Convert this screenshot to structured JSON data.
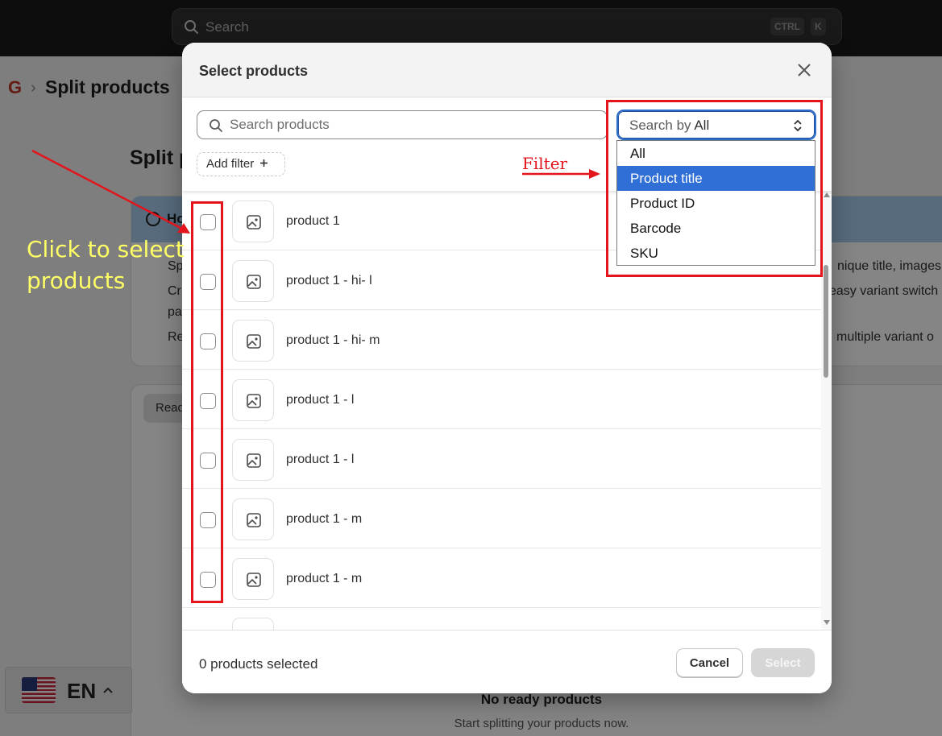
{
  "topbar": {
    "search_placeholder": "Search",
    "shortcut_keys": [
      "CTRL",
      "K"
    ]
  },
  "breadcrumb": {
    "logo": "G",
    "separator": "›",
    "title": "Split products"
  },
  "page": {
    "heading": "Split p",
    "info_title": "Ho",
    "info_lines": [
      "Sp",
      "Cr",
      "pa",
      "Re"
    ],
    "info_right_lines": [
      "nique title, images,",
      "easy variant switch",
      "multiple variant o"
    ],
    "tab_label": "Read",
    "empty_title": "No ready products",
    "empty_subtitle": "Start splitting your products now."
  },
  "language": {
    "code": "EN"
  },
  "modal": {
    "title": "Select products",
    "search_placeholder": "Search products",
    "search_by_label": "Search by",
    "search_by_value": "All",
    "add_filter_label": "Add filter",
    "dropdown_options": [
      "All",
      "Product title",
      "Product ID",
      "Barcode",
      "SKU"
    ],
    "dropdown_highlighted": "Product title",
    "products": [
      "product 1",
      "product 1 - hi- l",
      "product 1 - hi- m",
      "product 1 - l",
      "product 1 - l",
      "product 1 - m",
      "product 1 - m"
    ],
    "footer": {
      "selected_count": "0 products selected",
      "cancel_label": "Cancel",
      "select_label": "Select"
    }
  },
  "annotations": {
    "click_to_select": [
      "Click to select",
      "products"
    ],
    "filter": "Filter",
    "color": "#e3141b",
    "label_color": "#ffff66"
  },
  "colors": {
    "topbar": "#1a1a1a",
    "primary_blue": "#2c6ecb",
    "highlight": "#2f6fd6",
    "info_banner": "#a8cdf0"
  }
}
